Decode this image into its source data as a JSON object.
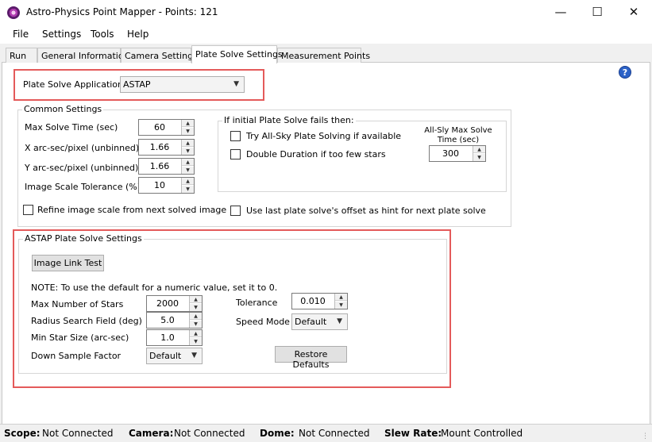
{
  "window": {
    "title": "Astro-Physics Point Mapper - Points: 121",
    "minimize": "—",
    "maximize": "☐",
    "close": "✕"
  },
  "menu": [
    "File",
    "Settings",
    "Tools",
    "Help"
  ],
  "tabs": [
    "Run",
    "General Information",
    "Camera Settings",
    "Plate Solve Settings",
    "Measurement Points"
  ],
  "active_tab": "Plate Solve Settings",
  "plate_solve_app": {
    "label": "Plate Solve Application:",
    "value": "ASTAP"
  },
  "common": {
    "title": "Common Settings",
    "max_solve_time": {
      "label": "Max Solve Time (sec)",
      "value": "60"
    },
    "x_arcsec": {
      "label": "X arc-sec/pixel (unbinned)",
      "value": "1.66"
    },
    "y_arcsec": {
      "label": "Y arc-sec/pixel (unbinned)",
      "value": "1.66"
    },
    "scale_tolerance": {
      "label": "Image Scale Tolerance (%)",
      "value": "10"
    },
    "refine_scale": {
      "label": "Refine image scale from next solved image",
      "checked": false
    },
    "use_last_offset": {
      "label": "Use last plate solve's offset as hint for next plate solve",
      "checked": false
    },
    "fail": {
      "title": "If initial Plate Solve fails then:",
      "all_sky": {
        "label": "Try All-Sky Plate Solving if available",
        "checked": false
      },
      "double_duration": {
        "label": "Double Duration if too few stars",
        "checked": false
      },
      "all_sky_max_label_line1": "All-Sly Max Solve",
      "all_sky_max_label_line2": "Time (sec)",
      "all_sky_max_value": "300"
    }
  },
  "astap": {
    "title": "ASTAP Plate Solve Settings",
    "image_link_test": "Image Link Test",
    "note": "NOTE: To use the default for a numeric value, set it to 0.",
    "max_stars": {
      "label": "Max Number of Stars",
      "value": "2000"
    },
    "radius": {
      "label": "Radius Search Field (deg)",
      "value": "5.0"
    },
    "min_star": {
      "label": "Min Star Size (arc-sec)",
      "value": "1.0"
    },
    "down_sample": {
      "label": "Down Sample Factor",
      "value": "Default"
    },
    "tolerance": {
      "label": "Tolerance",
      "value": "0.010"
    },
    "speed_mode": {
      "label": "Speed Mode",
      "value": "Default"
    },
    "restore_defaults": "Restore Defaults"
  },
  "status": {
    "scope_label": "Scope:",
    "scope_value": "Not Connected",
    "camera_label": "Camera:",
    "camera_value": "Not Connected",
    "dome_label": "Dome:",
    "dome_value": "Not Connected",
    "slew_label": "Slew Rate:",
    "slew_value": "Mount Controlled"
  },
  "colors": {
    "highlight": "#e45a5a",
    "help": "#2c62c7"
  }
}
